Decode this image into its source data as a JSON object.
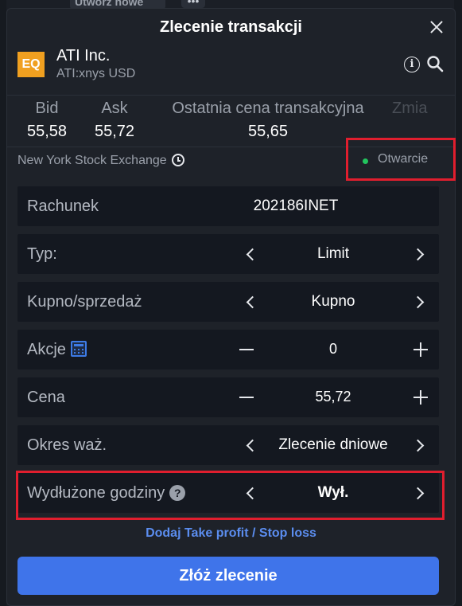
{
  "background": {
    "tab_label": "Utwórz nowe",
    "dots": "•••"
  },
  "modal": {
    "title": "Zlecenie transakcji",
    "instrument": {
      "badge": "EQ",
      "name": "ATI Inc.",
      "symbol": "ATI:xnys USD"
    },
    "quotes": [
      {
        "label": "Bid",
        "value": "55,58"
      },
      {
        "label": "Ask",
        "value": "55,72"
      },
      {
        "label": "Ostatnia cena transakcyjna",
        "value": "55,65"
      },
      {
        "label": "Zmia",
        "value": ""
      }
    ],
    "exchange": "New York Stock Exchange",
    "market_status": "Otwarcie",
    "rows": {
      "account": {
        "label": "Rachunek",
        "value": "202186INET"
      },
      "type": {
        "label": "Typ:",
        "value": "Limit"
      },
      "side": {
        "label": "Kupno/sprzedaż",
        "value": "Kupno"
      },
      "quantity": {
        "label": "Akcje",
        "value": "0"
      },
      "price": {
        "label": "Cena",
        "value": "55,72"
      },
      "duration": {
        "label": "Okres waż.",
        "value": "Zlecenie dniowe"
      },
      "extended": {
        "label": "Wydłużone godziny",
        "value": "Wył.",
        "help": "?"
      }
    },
    "add_tpsl": "Dodaj Take profit / Stop loss",
    "submit": "Złóż zlecenie"
  },
  "colors": {
    "accent": "#3f74ea",
    "link": "#5b8def",
    "status_open": "#22c55e",
    "highlight": "#e01e2e",
    "badge": "#f0a020"
  }
}
